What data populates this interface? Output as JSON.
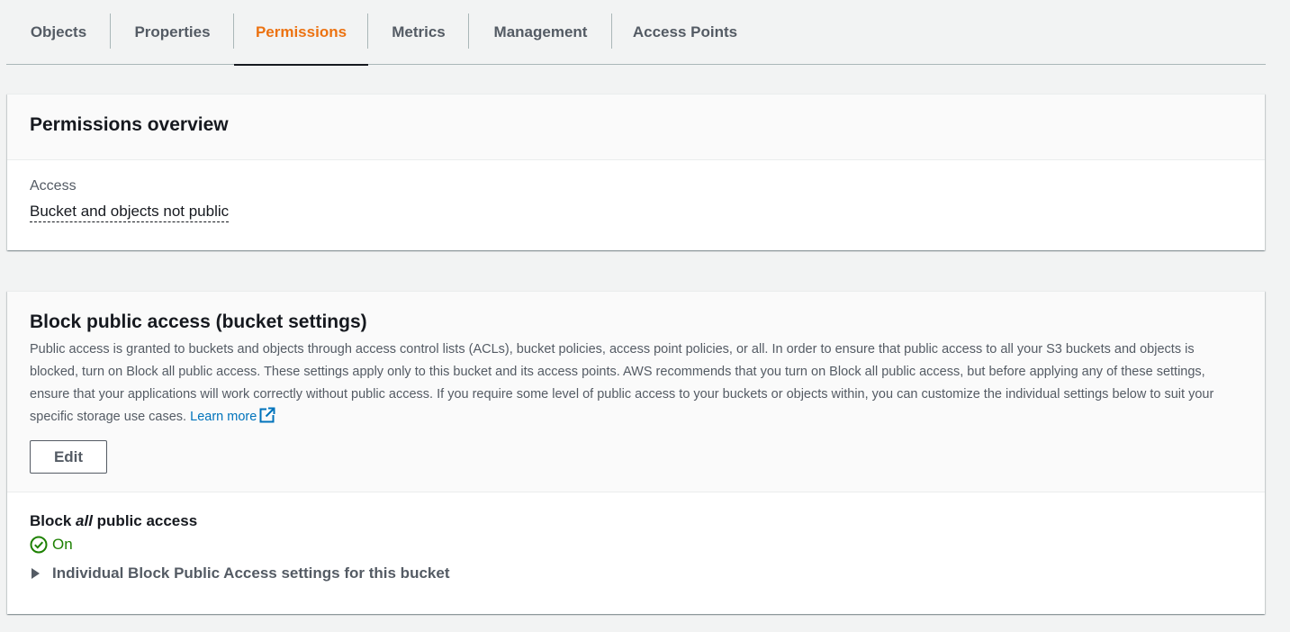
{
  "tabs": [
    {
      "label": "Objects",
      "active": false
    },
    {
      "label": "Properties",
      "active": false
    },
    {
      "label": "Permissions",
      "active": true
    },
    {
      "label": "Metrics",
      "active": false
    },
    {
      "label": "Management",
      "active": false
    },
    {
      "label": "Access Points",
      "active": false
    }
  ],
  "overview": {
    "title": "Permissions overview",
    "access_label": "Access",
    "access_value": "Bucket and objects not public"
  },
  "block_public_access": {
    "title": "Block public access (bucket settings)",
    "description": "Public access is granted to buckets and objects through access control lists (ACLs), bucket policies, access point policies, or all. In order to ensure that public access to all your S3 buckets and objects is blocked, turn on Block all public access. These settings apply only to this bucket and its access points. AWS recommends that you turn on Block all public access, but before applying any of these settings, ensure that your applications will work correctly without public access. If you require some level of public access to your buckets or objects within, you can customize the individual settings below to suit your specific storage use cases.",
    "learn_more": "Learn more",
    "learn_more_icon": "external-link-icon",
    "edit_label": "Edit",
    "block_all_prefix": "Block ",
    "block_all_em": "all",
    "block_all_suffix": " public access",
    "status": "On",
    "status_icon": "check-circle-icon",
    "expander_label": "Individual Block Public Access settings for this bucket"
  },
  "colors": {
    "active_tab": "#ec7211",
    "link": "#0073bb",
    "success": "#1d8102",
    "background": "#f2f3f3"
  }
}
